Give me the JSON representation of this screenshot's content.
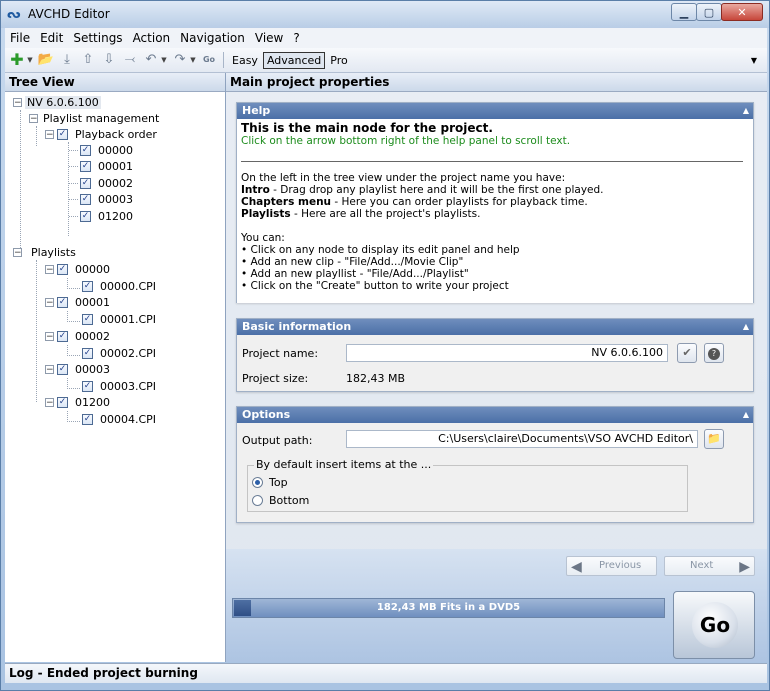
{
  "window": {
    "title": "AVCHD Editor",
    "app_icon": "vso-logo-icon"
  },
  "menu": [
    "File",
    "Edit",
    "Settings",
    "Action",
    "Navigation",
    "View",
    "?"
  ],
  "toolbar": {
    "modes": [
      "Easy",
      "Advanced",
      "Pro"
    ],
    "selected_mode": "Advanced"
  },
  "tree_view": {
    "title": "Tree View",
    "root": "NV 6.0.6.100",
    "playlist_management": "Playlist management",
    "playback_order": "Playback order",
    "playback_items": [
      "00000",
      "00001",
      "00002",
      "00003",
      "01200"
    ],
    "playlists_label": "Playlists",
    "playlists": [
      {
        "name": "00000",
        "clip": "00000.CPI"
      },
      {
        "name": "00001",
        "clip": "00001.CPI"
      },
      {
        "name": "00002",
        "clip": "00002.CPI"
      },
      {
        "name": "00003",
        "clip": "00003.CPI"
      },
      {
        "name": "01200",
        "clip": "00004.CPI"
      }
    ]
  },
  "main": {
    "title": "Main project properties",
    "help": {
      "header": "Help",
      "title": "This is the main node for the project.",
      "hint": "Click on the arrow bottom right of the help panel to scroll text.",
      "intro_line": "On the left in the tree view under the project name you have:",
      "items": [
        {
          "bold": "Intro",
          "text": " - Drag drop any playlist here and it will be the first one played."
        },
        {
          "bold": "Chapters menu",
          "text": " - Here you can order playlists for playback time."
        },
        {
          "bold": "Playlists",
          "text": " - Here are all the project's playlists."
        }
      ],
      "you_can": "You can:",
      "bullets": [
        "Click on any node to display its edit panel and help",
        "Add an new clip - \"File/Add.../Movie Clip\"",
        "Add an new playllist - \"File/Add.../Playlist\"",
        "Click on the \"Create\" button to write your project"
      ]
    },
    "basic": {
      "header": "Basic information",
      "project_name_label": "Project name:",
      "project_name_value": "NV 6.0.6.100",
      "project_size_label": "Project size:",
      "project_size_value": "182,43 MB"
    },
    "options": {
      "header": "Options",
      "output_path_label": "Output path:",
      "output_path_value": "C:\\Users\\claire\\Documents\\VSO AVCHD Editor\\",
      "insert_group_label": "By default insert items at the ...",
      "radio_top": "Top",
      "radio_bottom": "Bottom",
      "selected": "Top"
    }
  },
  "navigation": {
    "previous": "Previous",
    "next": "Next"
  },
  "progress": {
    "text": "182,43 MB Fits in a DVD5",
    "fraction": 0.04
  },
  "go_button": "Go",
  "status": "Log - Ended project burning",
  "colors": {
    "help_hint": "#1d8c1d",
    "group_header": "#4b6fa7",
    "progress_fill": "#2f4f86"
  }
}
